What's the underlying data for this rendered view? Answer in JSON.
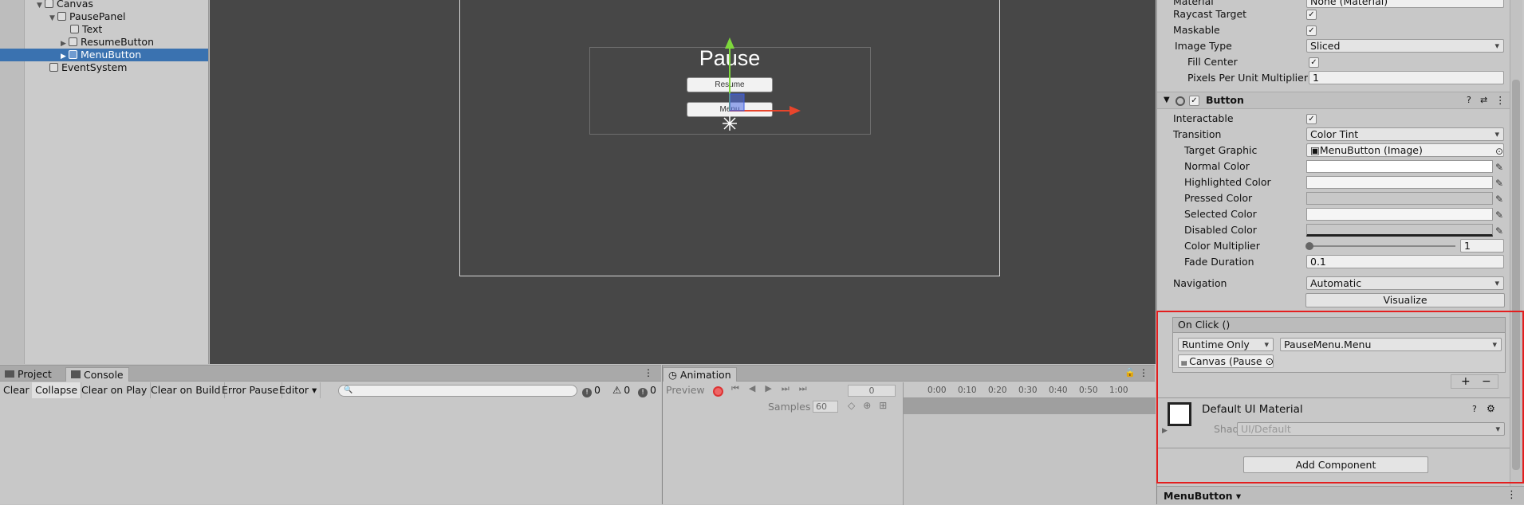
{
  "hierarchy": {
    "items": [
      {
        "label": "Canvas"
      },
      {
        "label": "PausePanel"
      },
      {
        "label": "Text"
      },
      {
        "label": "ResumeButton"
      },
      {
        "label": "MenuButton"
      },
      {
        "label": "EventSystem"
      }
    ]
  },
  "scene": {
    "title": "Pause",
    "resume_label": "Resume",
    "menu_label": "Menu"
  },
  "console": {
    "tabs": [
      "Project",
      "Console"
    ],
    "toolbar": [
      "Clear",
      "Collapse",
      "Clear on Play",
      "Clear on Build",
      "Error Pause",
      "Editor ▾"
    ],
    "search_placeholder": "",
    "counts": {
      "errors": "0",
      "warnings": "0",
      "messages": "0"
    }
  },
  "animation": {
    "tab": "Animation",
    "preview_label": "Preview",
    "frame_value": "0",
    "samples_label": "Samples",
    "samples_value": "60",
    "ruler": [
      "0:00",
      "0:10",
      "0:20",
      "0:30",
      "0:40",
      "0:50",
      "1:00"
    ]
  },
  "inspector": {
    "image": {
      "material_label": "Material",
      "material_value": "None (Material)",
      "raycast_label": "Raycast Target",
      "maskable_label": "Maskable",
      "image_type_label": "Image Type",
      "image_type_value": "Sliced",
      "fill_center_label": "Fill Center",
      "ppu_label": "Pixels Per Unit Multiplier",
      "ppu_value": "1"
    },
    "button": {
      "title": "Button",
      "interactable_label": "Interactable",
      "transition_label": "Transition",
      "transition_value": "Color Tint",
      "target_graphic_label": "Target Graphic",
      "target_graphic_value": "MenuButton (Image)",
      "normal_label": "Normal Color",
      "highlighted_label": "Highlighted Color",
      "pressed_label": "Pressed Color",
      "selected_label": "Selected Color",
      "disabled_label": "Disabled Color",
      "multiplier_label": "Color Multiplier",
      "multiplier_value": "1",
      "fade_label": "Fade Duration",
      "fade_value": "0.1",
      "navigation_label": "Navigation",
      "navigation_value": "Automatic",
      "visualize_label": "Visualize"
    },
    "onclick": {
      "header": "On Click ()",
      "mode": "Runtime Only",
      "function": "PauseMenu.Menu",
      "object": "Canvas (Pause"
    },
    "material": {
      "title": "Default UI Material",
      "shader_label": "Shader",
      "shader_value": "UI/Default"
    },
    "add_component_label": "Add Component",
    "footer_label": "MenuButton ▾"
  },
  "colors": {
    "selection": "#3a72b0",
    "highlight_border": "#e31e1e",
    "gizmo_y": "#7ed83c",
    "gizmo_x": "#e8452c"
  }
}
